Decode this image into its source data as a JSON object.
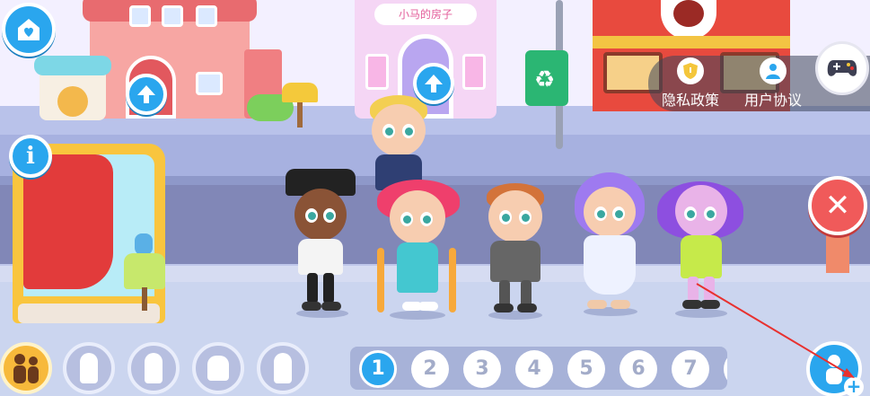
{
  "scene": {
    "house_sign": "小马的房子"
  },
  "top_right": {
    "privacy_label": "隐私政策",
    "agreement_label": "用户协议",
    "privacy_icon": "shield-icon",
    "agreement_icon": "user-icon",
    "game_icon": "gamepad-icon"
  },
  "left_controls": {
    "home_icon": "home-heart-icon",
    "info_icon": "info-icon",
    "info_glyph": "i"
  },
  "close_glyph": "✕",
  "characters": [
    "police-officer",
    "blonde-boy",
    "girl-with-crutches",
    "ginger-boy",
    "purple-hair-girl",
    "purple-pigtail-girl"
  ],
  "category_slots": [
    {
      "icon": "family-icon",
      "active": true
    },
    {
      "icon": "child-icon",
      "active": false
    },
    {
      "icon": "adult-icon",
      "active": false
    },
    {
      "icon": "baby-icon",
      "active": false
    },
    {
      "icon": "add-character-icon",
      "active": false
    }
  ],
  "pager": {
    "pages": [
      "1",
      "2",
      "3",
      "4",
      "5",
      "6",
      "7"
    ],
    "current": "1"
  },
  "add_button": {
    "plus_glyph": "+"
  },
  "colors": {
    "accent_blue": "#2aa6ee",
    "close_red": "#f05a5a",
    "arrow_red": "#e8312f"
  }
}
